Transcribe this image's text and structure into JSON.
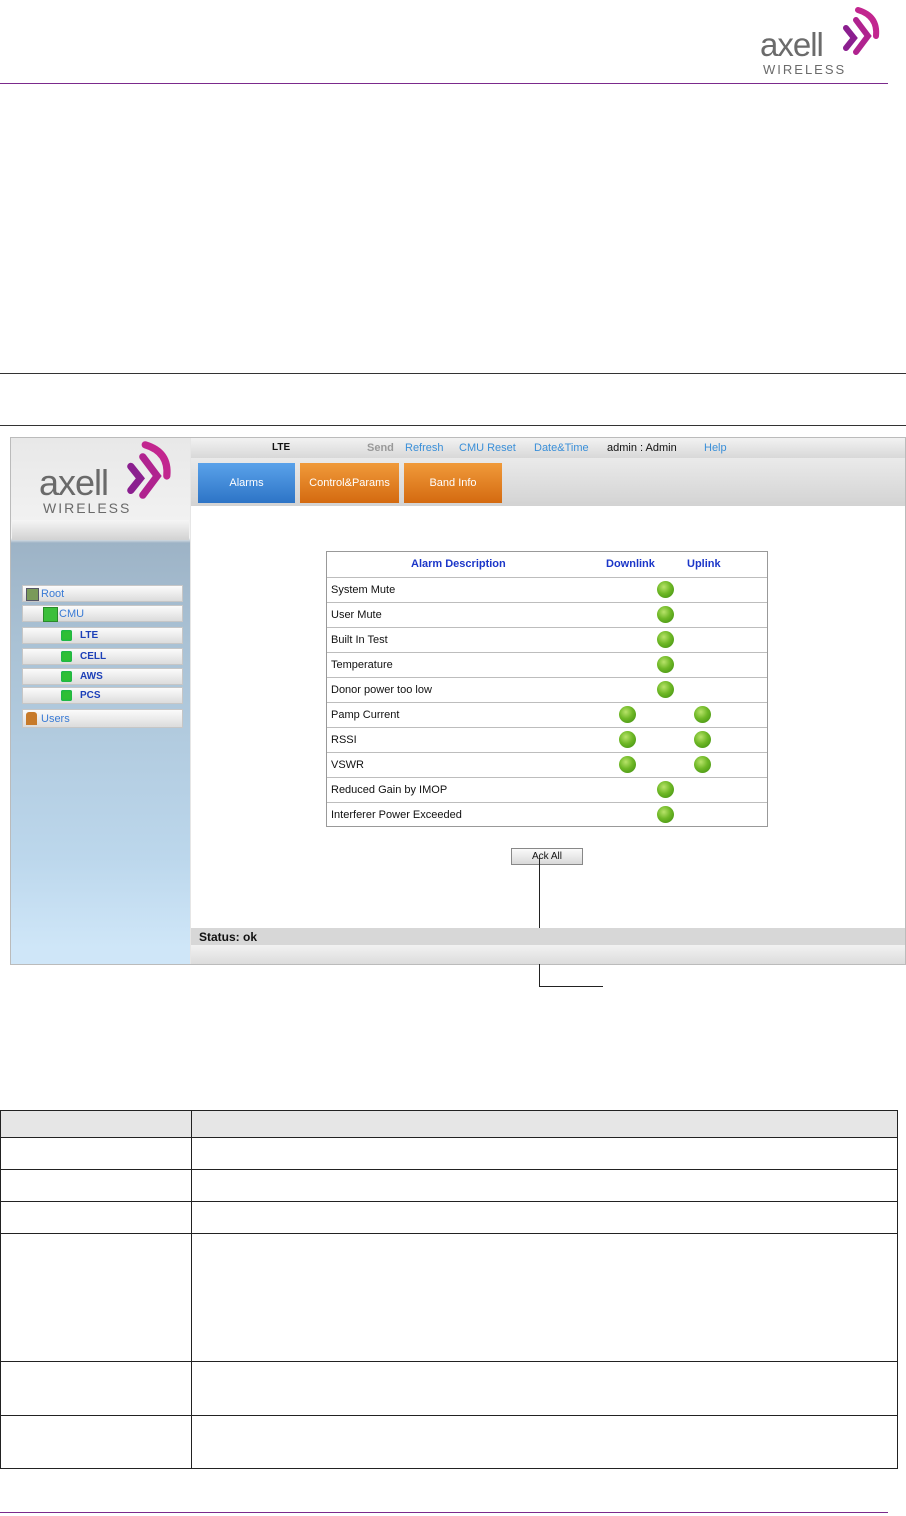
{
  "header": {
    "logo_word": "axell",
    "logo_sub": "WIRELESS"
  },
  "app": {
    "sidebar": {
      "logo_word": "axell",
      "logo_sub": "WIRELESS",
      "tree": [
        {
          "label": "Root",
          "icon": "root-icon"
        },
        {
          "label": "CMU",
          "icon": "cmu-icon"
        },
        {
          "label": "LTE",
          "icon": "status-green-icon"
        },
        {
          "label": "CELL",
          "icon": "status-green-icon"
        },
        {
          "label": "AWS",
          "icon": "status-green-icon"
        },
        {
          "label": "PCS",
          "icon": "status-green-icon"
        },
        {
          "label": "Users",
          "icon": "users-icon"
        }
      ]
    },
    "topbar": {
      "band": "LTE",
      "send": "Send",
      "refresh": "Refresh",
      "cmu_reset": "CMU Reset",
      "date_time": "Date&Time",
      "user": "admin : Admin",
      "help": "Help"
    },
    "tabs": [
      {
        "label": "Alarms",
        "color": "#3b86d6"
      },
      {
        "label": "Control&Params",
        "color": "#e07a1c"
      },
      {
        "label": "Band Info",
        "color": "#e07a1c"
      }
    ],
    "alarm_table": {
      "headers": {
        "description": "Alarm Description",
        "downlink": "Downlink",
        "uplink": "Uplink"
      },
      "rows": [
        {
          "description": "System Mute",
          "status": "ok",
          "led": "combined"
        },
        {
          "description": "User Mute",
          "status": "ok",
          "led": "combined"
        },
        {
          "description": "Built In Test",
          "status": "ok",
          "led": "combined"
        },
        {
          "description": "Temperature",
          "status": "ok",
          "led": "combined"
        },
        {
          "description": "Donor power too low",
          "status": "ok",
          "led": "combined"
        },
        {
          "description": "Pamp Current",
          "status": "ok",
          "led": "both"
        },
        {
          "description": "RSSI",
          "status": "ok",
          "led": "both"
        },
        {
          "description": "VSWR",
          "status": "ok",
          "led": "both"
        },
        {
          "description": "Reduced Gain by IMOP",
          "status": "ok",
          "led": "combined"
        },
        {
          "description": "Interferer Power Exceeded",
          "status": "ok",
          "led": "combined"
        }
      ]
    },
    "ack_button": "Ack All",
    "status": "Status: ok",
    "led_color": "#6fb826"
  }
}
